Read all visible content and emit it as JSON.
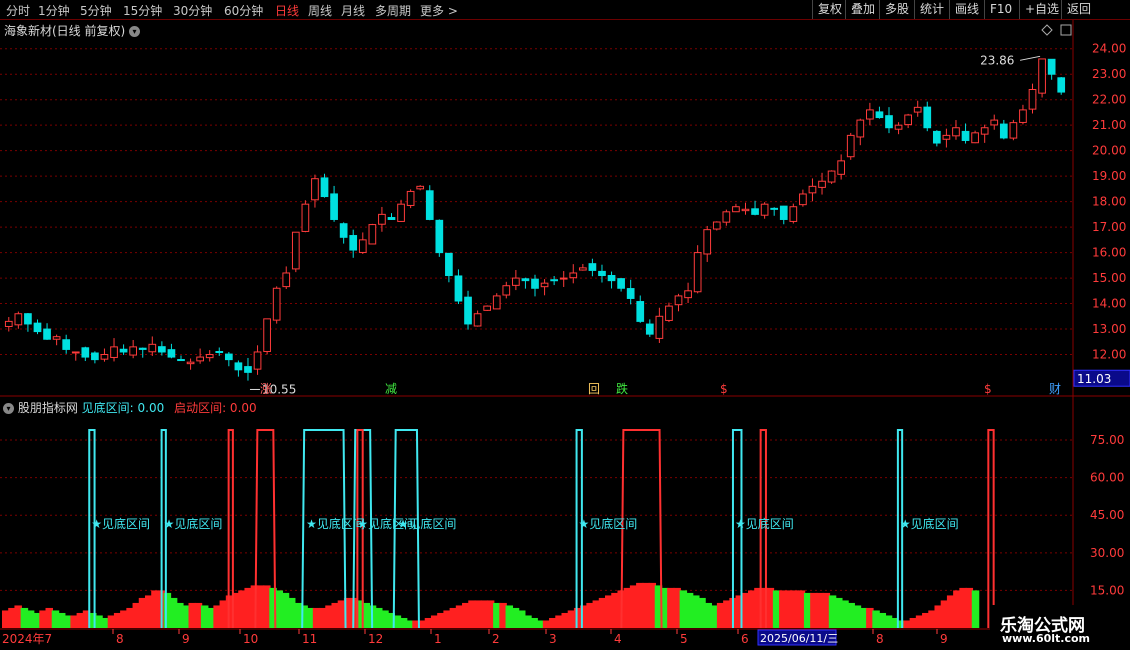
{
  "toolbar": {
    "tabs": [
      "分时",
      "1分钟",
      "5分钟",
      "15分钟",
      "30分钟",
      "60分钟",
      "日线",
      "周线",
      "月线",
      "多周期",
      "更多 >"
    ],
    "active_tab": "日线",
    "right_buttons": [
      "复权",
      "叠加",
      "多股",
      "统计",
      "画线",
      "F10",
      "+自选",
      "返回"
    ]
  },
  "main": {
    "title": "海象新材(日线 前复权)",
    "high_label": "23.86",
    "low_label": "10.55",
    "current_price": "11.03"
  },
  "indicator": {
    "name": "股朋指标网",
    "label1": "见底区间: 0.00",
    "label2": "启动区间: 0.00",
    "marker_text": "见底区间"
  },
  "date_axis": {
    "first": "2024年7",
    "months": [
      "8",
      "9",
      "10",
      "11",
      "12",
      "1",
      "2",
      "3",
      "4",
      "5",
      "6",
      "8",
      "9"
    ],
    "cursor_label": "2025/06/11/三"
  },
  "event_markers": [
    "涨",
    "减",
    "回",
    "跌",
    "$",
    "$",
    "财"
  ],
  "watermark": {
    "line1": "乐淘公式网",
    "line2": "www.60lt.com"
  },
  "colors": {
    "up": "#ff3b3b",
    "down": "#00e0e0",
    "green": "#22ee22",
    "cyan": "#40e8f0",
    "grid": "#7a0000"
  },
  "chart_data": [
    {
      "type": "candlestick",
      "title": "海象新材(日线 前复权)",
      "ylim": [
        11.0,
        24.5
      ],
      "yticks": [
        12,
        13,
        14,
        15,
        16,
        17,
        18,
        19,
        20,
        21,
        22,
        23,
        24
      ],
      "annotations": [
        {
          "label": "23.86",
          "type": "high"
        },
        {
          "label": "10.55",
          "type": "low"
        }
      ],
      "close_series": [
        13.3,
        13.6,
        13.2,
        12.9,
        12.6,
        12.7,
        12.2,
        12.1,
        11.9,
        11.8,
        12.0,
        12.3,
        12.1,
        12.3,
        12.2,
        12.4,
        12.1,
        11.9,
        11.8,
        11.7,
        11.9,
        12.0,
        12.1,
        11.8,
        11.4,
        11.3,
        12.1,
        13.4,
        14.6,
        15.2,
        16.8,
        17.9,
        18.9,
        18.2,
        17.3,
        16.6,
        16.1,
        16.5,
        17.1,
        17.5,
        17.3,
        17.9,
        18.4,
        18.6,
        17.3,
        16.0,
        15.1,
        14.1,
        13.2,
        13.6,
        13.9,
        14.3,
        14.7,
        15.0,
        14.9,
        14.6,
        14.8,
        14.9,
        15.0,
        15.2,
        15.4,
        15.3,
        15.1,
        14.9,
        14.6,
        14.2,
        13.3,
        12.8,
        13.5,
        13.9,
        14.3,
        14.5,
        16.0,
        16.9,
        17.2,
        17.6,
        17.8,
        17.7,
        17.5,
        17.9,
        17.7,
        17.3,
        17.8,
        18.3,
        18.6,
        18.8,
        19.2,
        19.6,
        20.6,
        21.2,
        21.6,
        21.3,
        20.9,
        21.0,
        21.4,
        21.7,
        20.9,
        20.3,
        20.6,
        20.9,
        20.4,
        20.7,
        20.9,
        21.2,
        20.5,
        21.1,
        21.6,
        22.4,
        23.6,
        23.0,
        22.3
      ],
      "series": [
        {
          "name": "ma-red",
          "values": []
        },
        {
          "name": "ma-blue",
          "values": []
        }
      ]
    },
    {
      "type": "bar",
      "title": "股朋指标网",
      "ylim": [
        0,
        85
      ],
      "yticks": [
        15,
        30,
        45,
        60,
        75
      ],
      "histogram": [
        7,
        8,
        9,
        8,
        7,
        6,
        7,
        8,
        7,
        6,
        5,
        5,
        6,
        7,
        6,
        5,
        4,
        5,
        6,
        7,
        8,
        10,
        12,
        13,
        15,
        15,
        14,
        12,
        10,
        9,
        10,
        10,
        9,
        8,
        9,
        11,
        13,
        14,
        15,
        16,
        17,
        17,
        17,
        16,
        15,
        14,
        12,
        10,
        9,
        8,
        8,
        8,
        9,
        10,
        11,
        12,
        12,
        11,
        10,
        9,
        8,
        7,
        6,
        5,
        4,
        3,
        3,
        3,
        4,
        5,
        6,
        7,
        8,
        9,
        10,
        11,
        11,
        11,
        11,
        10,
        10,
        9,
        8,
        7,
        5,
        4,
        3,
        3,
        4,
        5,
        6,
        7,
        8,
        9,
        10,
        11,
        12,
        13,
        14,
        15,
        16,
        17,
        18,
        18,
        18,
        17,
        16,
        16,
        16,
        15,
        14,
        13,
        12,
        10,
        9,
        10,
        11,
        12,
        13,
        14,
        15,
        16,
        16,
        16,
        15,
        15,
        15,
        15,
        15,
        14,
        14,
        14,
        14,
        13,
        12,
        11,
        10,
        9,
        8,
        8,
        7,
        6,
        5,
        4,
        3,
        3,
        4,
        5,
        6,
        7,
        9,
        11,
        13,
        15,
        16,
        16,
        15
      ],
      "cyan_signals": [
        {
          "from": 0.082,
          "to": 0.087,
          "kind": "spike"
        },
        {
          "from": 0.15,
          "to": 0.154,
          "kind": "spike"
        },
        {
          "from": 0.284,
          "to": 0.321,
          "kind": "plateau"
        },
        {
          "from": 0.332,
          "to": 0.346,
          "kind": "plateau"
        },
        {
          "from": 0.37,
          "to": 0.39,
          "kind": "plateau"
        },
        {
          "from": 0.54,
          "to": 0.545,
          "kind": "spike"
        },
        {
          "from": 0.687,
          "to": 0.695,
          "kind": "spike"
        },
        {
          "from": 0.842,
          "to": 0.846,
          "kind": "spike"
        }
      ],
      "red_signals": [
        {
          "from": 0.213,
          "to": 0.217,
          "kind": "spike"
        },
        {
          "from": 0.24,
          "to": 0.255,
          "kind": "plateau"
        },
        {
          "from": 0.334,
          "to": 0.339,
          "kind": "spike"
        },
        {
          "from": 0.584,
          "to": 0.618,
          "kind": "plateau"
        },
        {
          "from": 0.713,
          "to": 0.718,
          "kind": "spike"
        },
        {
          "from": 0.927,
          "to": 0.932,
          "kind": "spike"
        }
      ]
    }
  ]
}
